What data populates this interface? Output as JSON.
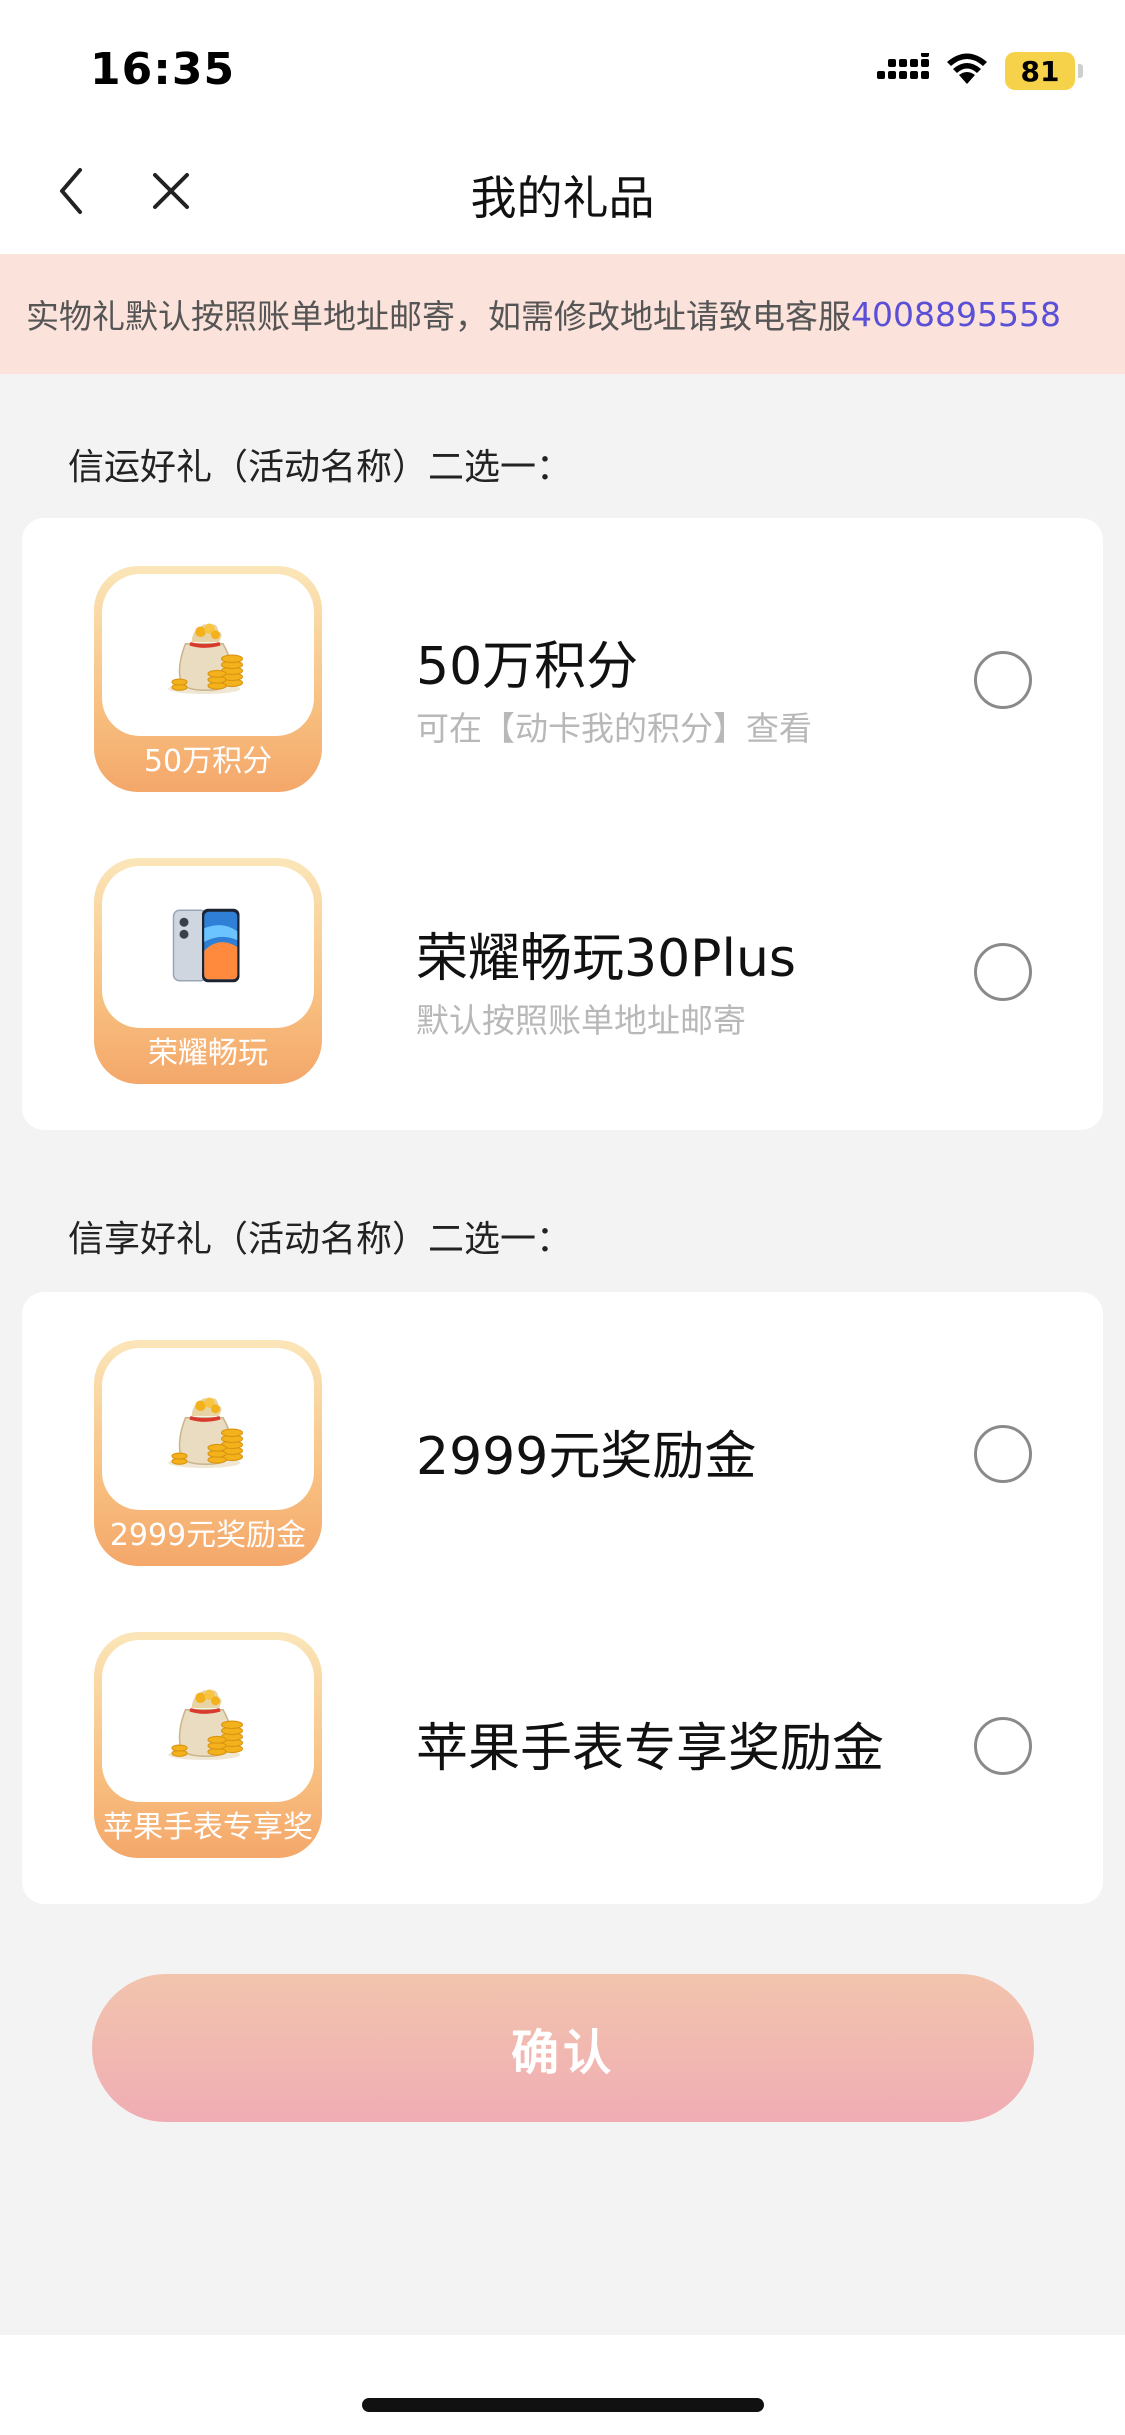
{
  "status_bar": {
    "time": "16:35",
    "battery": "81",
    "icons": [
      "cellular-signal-icon",
      "wifi-icon",
      "battery-icon"
    ]
  },
  "nav": {
    "title": "我的礼品",
    "back_icon": "chevron-left-icon",
    "close_icon": "close-icon"
  },
  "notice": {
    "text": "实物礼默认按照账单地址邮寄，如需修改地址请致电客服",
    "phone": "4008895558"
  },
  "sections": [
    {
      "title": "信运好礼（活动名称）二选一：",
      "items": [
        {
          "thumb_label": "50万积分",
          "title": "50万积分",
          "subtitle": "可在【动卡我的积分】查看",
          "icon": "money-bag-icon",
          "selected": false
        },
        {
          "thumb_label": "荣耀畅玩",
          "title": "荣耀畅玩30Plus",
          "subtitle": "默认按照账单地址邮寄",
          "icon": "smartphone-icon",
          "selected": false
        }
      ]
    },
    {
      "title": "信享好礼（活动名称）二选一：",
      "items": [
        {
          "thumb_label": "2999元奖励金",
          "title": "2999元奖励金",
          "subtitle": "",
          "icon": "money-bag-icon",
          "selected": false
        },
        {
          "thumb_label": "苹果手表专享奖",
          "title": "苹果手表专享奖励金",
          "subtitle": "",
          "icon": "money-bag-icon",
          "selected": false
        }
      ]
    }
  ],
  "confirm_label": "确认",
  "colors": {
    "accent_link": "#5a4fd6",
    "notice_bg": "#fbe3dc",
    "button_start": "#f2c4ad",
    "button_end": "#f0adb4"
  }
}
